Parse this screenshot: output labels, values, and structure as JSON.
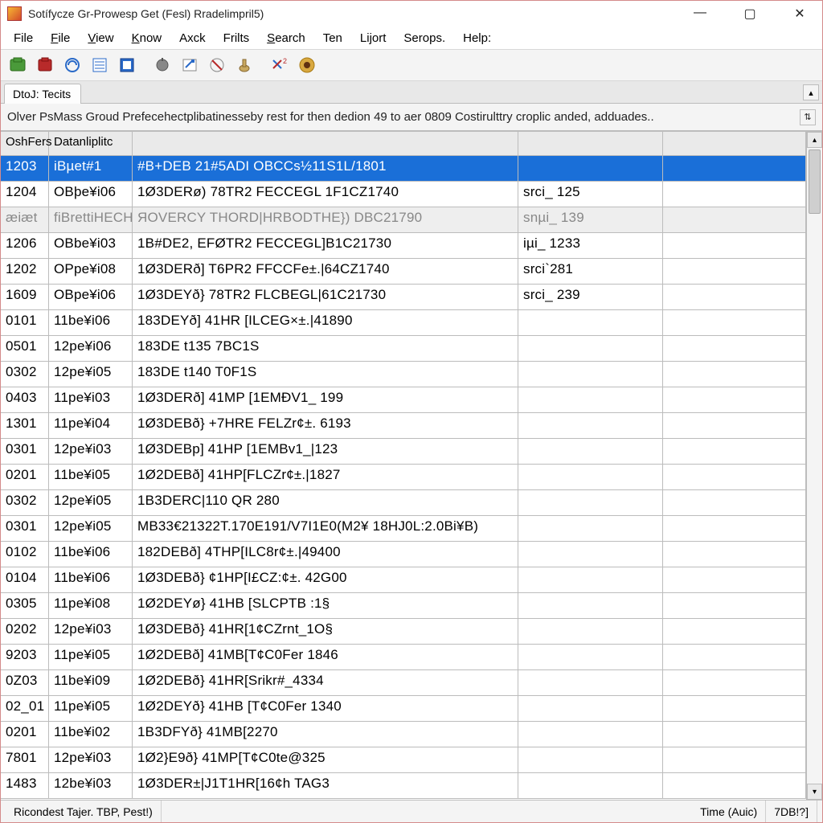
{
  "window": {
    "title": "Sotífycze Gr-Prowesp Get (Fesl) Rradelimpril5)"
  },
  "menu": [
    "File",
    "File",
    "View",
    "Know",
    "Axck",
    "Frilts",
    "Search",
    "Ten",
    "Lijort",
    "Serops.",
    "Help:"
  ],
  "tab_label": "DtoJ: Tecits",
  "info_text": "Olver PsMass Groud Prefecehectplibatinesseby rest for then dedion 49 to aer 0809 Costirulttry croplic anded, adduades..",
  "columns": [
    "OshFers",
    "Datanliplitc",
    "",
    ""
  ],
  "rows": [
    {
      "sel": true,
      "c0": "1203",
      "c1": "iBµet#1",
      "c2": "#B+DEB 21#5ADI OBCCs½11S1L/1801",
      "c3": ""
    },
    {
      "sel": false,
      "c0": "1204",
      "c1": "OBþe¥i06",
      "c2": "1Ø3DERø) 78TR2 FECCEGL 1F1CZ1740",
      "c3": "srci_ 125"
    },
    {
      "alt": true,
      "c0": "æiæt",
      "c1": "fiBrettiHECHIHET",
      "c2": "ЯOVERCY THORD|HRBODTHE}) DBC21790",
      "c3": "snµi_ 139"
    },
    {
      "sel": false,
      "c0": "1206",
      "c1": "OBbe¥i03",
      "c2": "1B#DE2, EFØTR2 FECCEGL]B1C21730",
      "c3": "iµi_ 1233"
    },
    {
      "sel": false,
      "c0": "1202",
      "c1": "OPpe¥i08",
      "c2": "1Ø3DERð] T6PR2 FFCCFe±.|64CZ1740",
      "c3": "srci`281"
    },
    {
      "sel": false,
      "c0": "1609",
      "c1": "OBpe¥i06",
      "c2": "1Ø3DEYð} 78TR2 FLCBEGL|61C21730",
      "c3": "srci_ 239"
    },
    {
      "sel": false,
      "c0": "0101",
      "c1": "11be¥i06",
      "c2": "183DEYð] 41HR [ILCEG×±.|41890",
      "c3": ""
    },
    {
      "sel": false,
      "c0": "0501",
      "c1": "12pe¥i06",
      "c2": "183DE  t135 7BC1S",
      "c3": ""
    },
    {
      "sel": false,
      "c0": "0302",
      "c1": "12pe¥i05",
      "c2": "183DE  t140 T0F1S",
      "c3": ""
    },
    {
      "sel": false,
      "c0": "0403",
      "c1": "11pe¥i03",
      "c2": "1Ø3DERð] 41MP [1EMĐV1_ 199",
      "c3": ""
    },
    {
      "sel": false,
      "c0": "1301",
      "c1": "11pe¥i04",
      "c2": "1Ø3DEBð} +7HRE FELZr¢±. 6193",
      "c3": ""
    },
    {
      "sel": false,
      "c0": "0301",
      "c1": "12pe¥i03",
      "c2": "1Ø3DEBp] 41HP [1EMBv1_|123",
      "c3": ""
    },
    {
      "sel": false,
      "c0": "0201",
      "c1": "11be¥i05",
      "c2": "1Ø2DEBð] 41HP[FLCZr¢±.|1827",
      "c3": ""
    },
    {
      "sel": false,
      "c0": "0302",
      "c1": "12pe¥i05",
      "c2": "1B3DERC|110 QR 280",
      "c3": ""
    },
    {
      "sel": false,
      "c0": "0301",
      "c1": "12pe¥i05",
      "c2": "MB33€21322T.170E191/V7I1E0(M2¥ 18HJ0L:2.0Bi¥B)",
      "c3": ""
    },
    {
      "sel": false,
      "c0": "0102",
      "c1": "11be¥i06",
      "c2": "182DEBð] 4THP[ILC8r¢±.|49400",
      "c3": ""
    },
    {
      "sel": false,
      "c0": "0104",
      "c1": "11be¥i06",
      "c2": "1Ø3DEBð} ¢1HP[I£CZ:¢±. 42G00",
      "c3": ""
    },
    {
      "sel": false,
      "c0": "0305",
      "c1": "11pe¥i08",
      "c2": "1Ø2DEYø} 41HB [SLCPTB :1§",
      "c3": ""
    },
    {
      "sel": false,
      "c0": "0202",
      "c1": "12pe¥i03",
      "c2": "1Ø3DEBð} 41HR[1¢CZrnt_1O§",
      "c3": ""
    },
    {
      "sel": false,
      "c0": "9203",
      "c1": "11pe¥i05",
      "c2": "1Ø2DEBð] 41MB[T¢C0Fer 1846",
      "c3": ""
    },
    {
      "sel": false,
      "c0": "0Z03",
      "c1": "11be¥i09",
      "c2": "1Ø2DEBð} 41HR[Srikr#_4334",
      "c3": ""
    },
    {
      "sel": false,
      "c0": "02_01",
      "c1": "11pe¥i05",
      "c2": "1Ø2DEYð} 41HB [T¢C0Fer 1340",
      "c3": ""
    },
    {
      "sel": false,
      "c0": "0201",
      "c1": "11be¥i02",
      "c2": "1B3DFYð} 41MB[2270",
      "c3": ""
    },
    {
      "sel": false,
      "c0": "7801",
      "c1": "12pe¥i03",
      "c2": "1Ø2}E9ð} 41MP[T¢C0te@325",
      "c3": ""
    },
    {
      "sel": false,
      "c0": "1483",
      "c1": "12be¥i03",
      "c2": "1Ø3DER±|J1T1HR[16¢h TAG3",
      "c3": ""
    }
  ],
  "status": {
    "left": "Ricondest Tajer.  TBP,  Pest!)",
    "mid": "Time (Auic)",
    "right": "7DB!?]"
  }
}
